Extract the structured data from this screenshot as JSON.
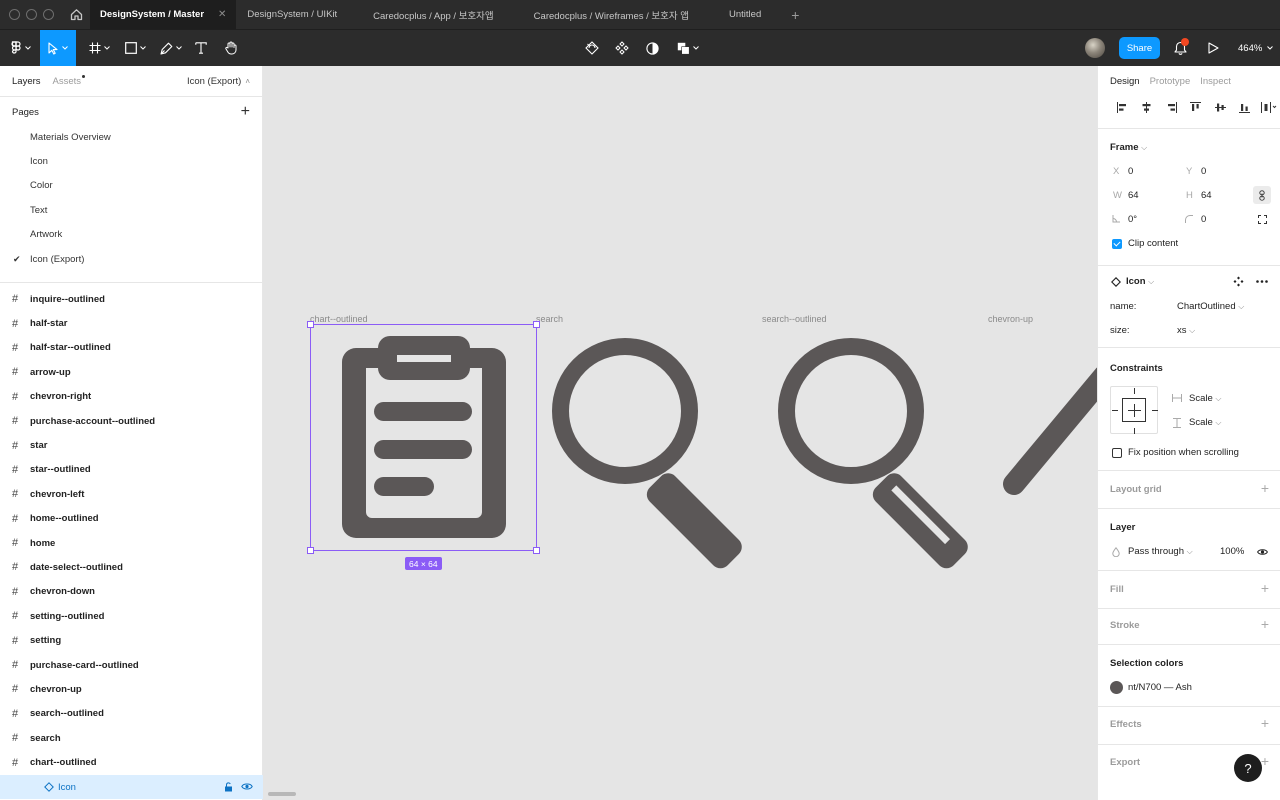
{
  "titlebar": {
    "tabs": [
      {
        "label": "DesignSystem / Master",
        "active": true
      },
      {
        "label": "DesignSystem / UIKit",
        "active": false
      },
      {
        "label": "Caredocplus / App / 보호자앱",
        "active": false
      },
      {
        "label": "Caredocplus / Wireframes / 보호자 앱",
        "active": false
      },
      {
        "label": "Untitled",
        "active": false
      }
    ],
    "close_glyph": "✕",
    "add_glyph": "+"
  },
  "toolbar": {
    "share_label": "Share",
    "zoom_label": "464%"
  },
  "left_panel": {
    "tab_layers": "Layers",
    "tab_assets": "Assets",
    "current_page": "Icon (Export)",
    "pages_title": "Pages",
    "pages": [
      {
        "label": "Materials Overview",
        "current": false
      },
      {
        "label": "Icon",
        "current": false
      },
      {
        "label": "Color",
        "current": false
      },
      {
        "label": "Text",
        "current": false
      },
      {
        "label": "Artwork",
        "current": false
      },
      {
        "label": "Icon (Export)",
        "current": true
      }
    ],
    "layers": [
      "inquire--outlined",
      "half-star",
      "half-star--outlined",
      "arrow-up",
      "chevron-right",
      "purchase-account--outlined",
      "star",
      "star--outlined",
      "chevron-left",
      "home--outlined",
      "home",
      "date-select--outlined",
      "chevron-down",
      "setting--outlined",
      "setting",
      "purchase-card--outlined",
      "chevron-up",
      "search--outlined",
      "search",
      "chart--outlined"
    ],
    "selected_layer": "Icon"
  },
  "canvas": {
    "frames": [
      {
        "label": "chart--outlined"
      },
      {
        "label": "search"
      },
      {
        "label": "search--outlined"
      },
      {
        "label": "chevron-up"
      }
    ],
    "size_badge": "64 × 64",
    "icon_color": "#5b5757",
    "selection_color": "#8b5cf6"
  },
  "right_panel": {
    "tabs": {
      "design": "Design",
      "prototype": "Prototype",
      "inspect": "Inspect"
    },
    "frame": {
      "title": "Frame",
      "x_label": "X",
      "x": "0",
      "y_label": "Y",
      "y": "0",
      "w_label": "W",
      "w": "64",
      "h_label": "H",
      "h": "64",
      "rotation": "0°",
      "radius": "0",
      "clip_content": "Clip content"
    },
    "component": {
      "title": "Icon",
      "name_label": "name:",
      "name_value": "ChartOutlined",
      "size_label": "size:",
      "size_value": "xs"
    },
    "constraints": {
      "title": "Constraints",
      "horizontal": "Scale",
      "vertical": "Scale",
      "fix_position": "Fix position when scrolling"
    },
    "layout_grid": "Layout grid",
    "layer": {
      "title": "Layer",
      "blend": "Pass through",
      "opacity": "100%"
    },
    "fill": "Fill",
    "stroke": "Stroke",
    "selection_colors": {
      "title": "Selection colors",
      "color_name": "nt/N700 — Ash",
      "swatch": "#5b5757"
    },
    "effects": "Effects",
    "export": "Export"
  },
  "help": "?"
}
